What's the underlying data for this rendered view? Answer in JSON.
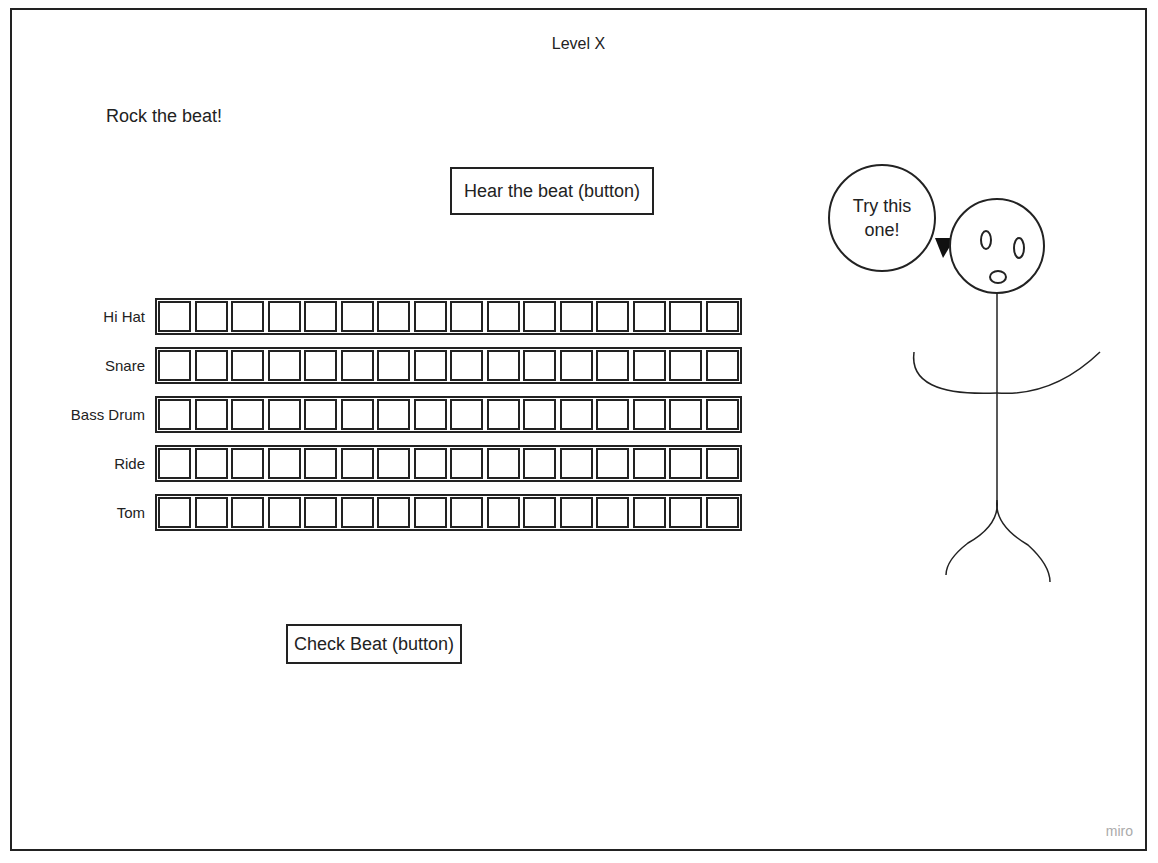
{
  "title": "Level X",
  "prompt": "Rock the beat!",
  "hear_button": "Hear the beat (button)",
  "tracks": [
    {
      "name": "Hi Hat",
      "steps": [
        false,
        false,
        false,
        false,
        false,
        false,
        false,
        false,
        false,
        false,
        false,
        false,
        false,
        false,
        false,
        false
      ]
    },
    {
      "name": "Snare",
      "steps": [
        false,
        false,
        false,
        false,
        false,
        false,
        false,
        false,
        false,
        false,
        false,
        false,
        false,
        false,
        false,
        false
      ]
    },
    {
      "name": "Bass Drum",
      "steps": [
        false,
        false,
        false,
        false,
        false,
        false,
        false,
        false,
        false,
        false,
        false,
        false,
        false,
        false,
        false,
        false
      ]
    },
    {
      "name": "Ride",
      "steps": [
        false,
        false,
        false,
        false,
        false,
        false,
        false,
        false,
        false,
        false,
        false,
        false,
        false,
        false,
        false,
        false
      ]
    },
    {
      "name": "Tom",
      "steps": [
        false,
        false,
        false,
        false,
        false,
        false,
        false,
        false,
        false,
        false,
        false,
        false,
        false,
        false,
        false,
        false
      ]
    }
  ],
  "check_button": "Check Beat (button)",
  "character": {
    "speech": "Try this one!"
  },
  "watermark": "miro"
}
